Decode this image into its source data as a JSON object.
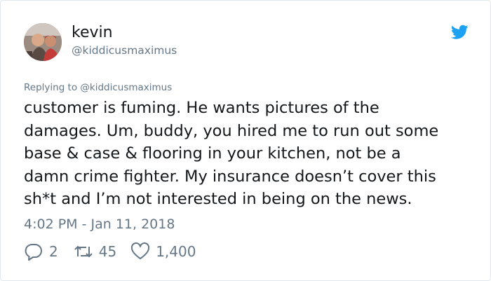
{
  "author": {
    "name": "kevin",
    "handle": "@kiddicusmaximus"
  },
  "reply_context": "Replying to @kiddicusmaximus",
  "tweet_text": "customer is fuming. He wants pictures of the\ndamages. Um, buddy, you hired me to run out some\nbase & case & flooring in your kitchen, not be a\ndamn crime fighter. My insurance doesn’t cover this\nsh*t and I’m not interested in being on the news.",
  "timestamp": "4:02 PM - Jan 11, 2018",
  "actions": {
    "replies": "2",
    "retweets": "45",
    "likes": "1,400"
  },
  "icons": {
    "brand": "twitter-bird-icon",
    "reply": "reply-icon",
    "retweet": "retweet-icon",
    "like": "heart-icon"
  },
  "colors": {
    "brand_blue": "#1da1f2",
    "secondary_text": "#657786",
    "primary_text": "#14171a",
    "border": "#e1e8ed"
  }
}
